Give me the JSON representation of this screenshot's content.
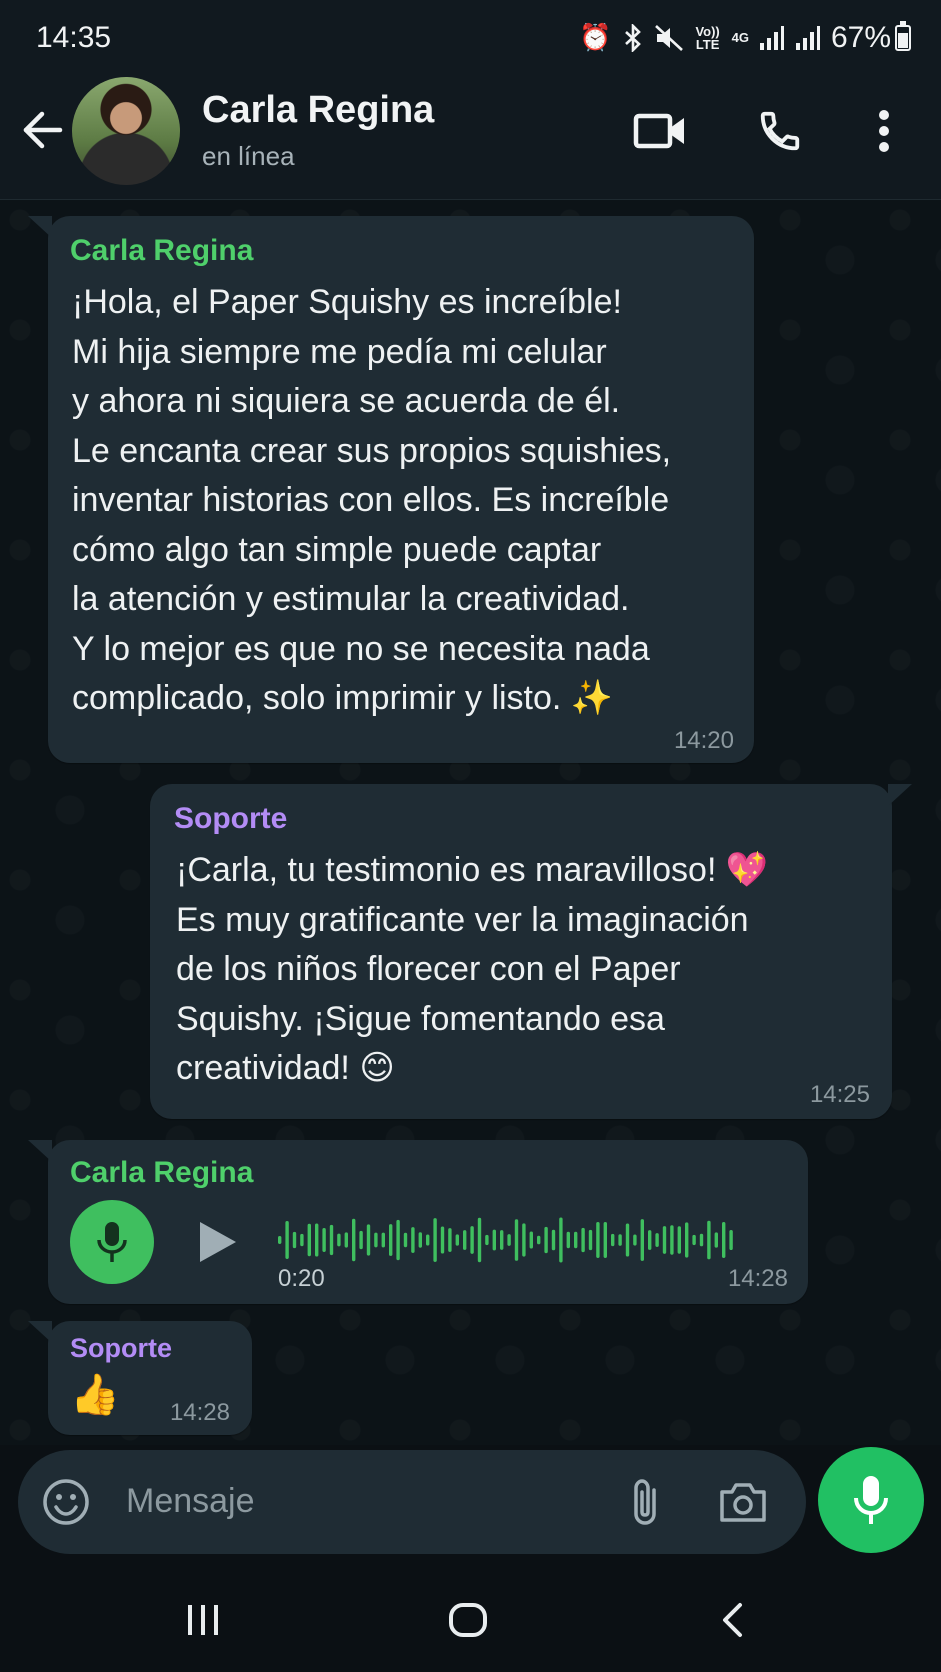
{
  "status_bar": {
    "time": "14:35",
    "volte_label": "Vo)) LTE",
    "network_label": "4G",
    "battery_percent": "67%",
    "battery_level": 0.67
  },
  "header": {
    "contact_name": "Carla Regina",
    "contact_status": "en línea"
  },
  "messages": [
    {
      "sender": "Carla Regina",
      "text": "¡Hola, el Paper Squishy es increíble!\nMi hija siempre me pedía mi celular\ny ahora ni siquiera se acuerda de él.\nLe encanta crear sus propios squishies,\ninventar historias con ellos. Es increíble\ncómo algo tan simple puede captar\nla atención y estimular la creatividad.\nY lo mejor es que no se necesita nada\ncomplicado, solo imprimir y listo. ✨",
      "time": "14:20"
    },
    {
      "sender": "Soporte",
      "text": "¡Carla, tu testimonio es maravilloso! 💖\nEs muy gratificante ver la imaginación\nde los niños florecer con el Paper\nSquishy. ¡Sigue fomentando esa\ncreatividad! 😊",
      "time": "14:25"
    },
    {
      "sender": "Carla Regina",
      "duration": "0:20",
      "time": "14:28"
    },
    {
      "sender": "Soporte",
      "text": "👍",
      "time": "14:28"
    }
  ],
  "input": {
    "placeholder": "Mensaje"
  },
  "icons": {
    "back": "arrow-left-icon",
    "video": "video-call-icon",
    "phone": "phone-icon",
    "more": "more-vertical-icon",
    "emoji": "emoji-icon",
    "attach": "paperclip-icon",
    "camera": "camera-icon",
    "mic": "microphone-icon"
  },
  "colors": {
    "accent_green": "#21c063",
    "sender_green": "#4fd06b",
    "sender_purple": "#b38cf5",
    "bubble": "#1f2c34"
  }
}
